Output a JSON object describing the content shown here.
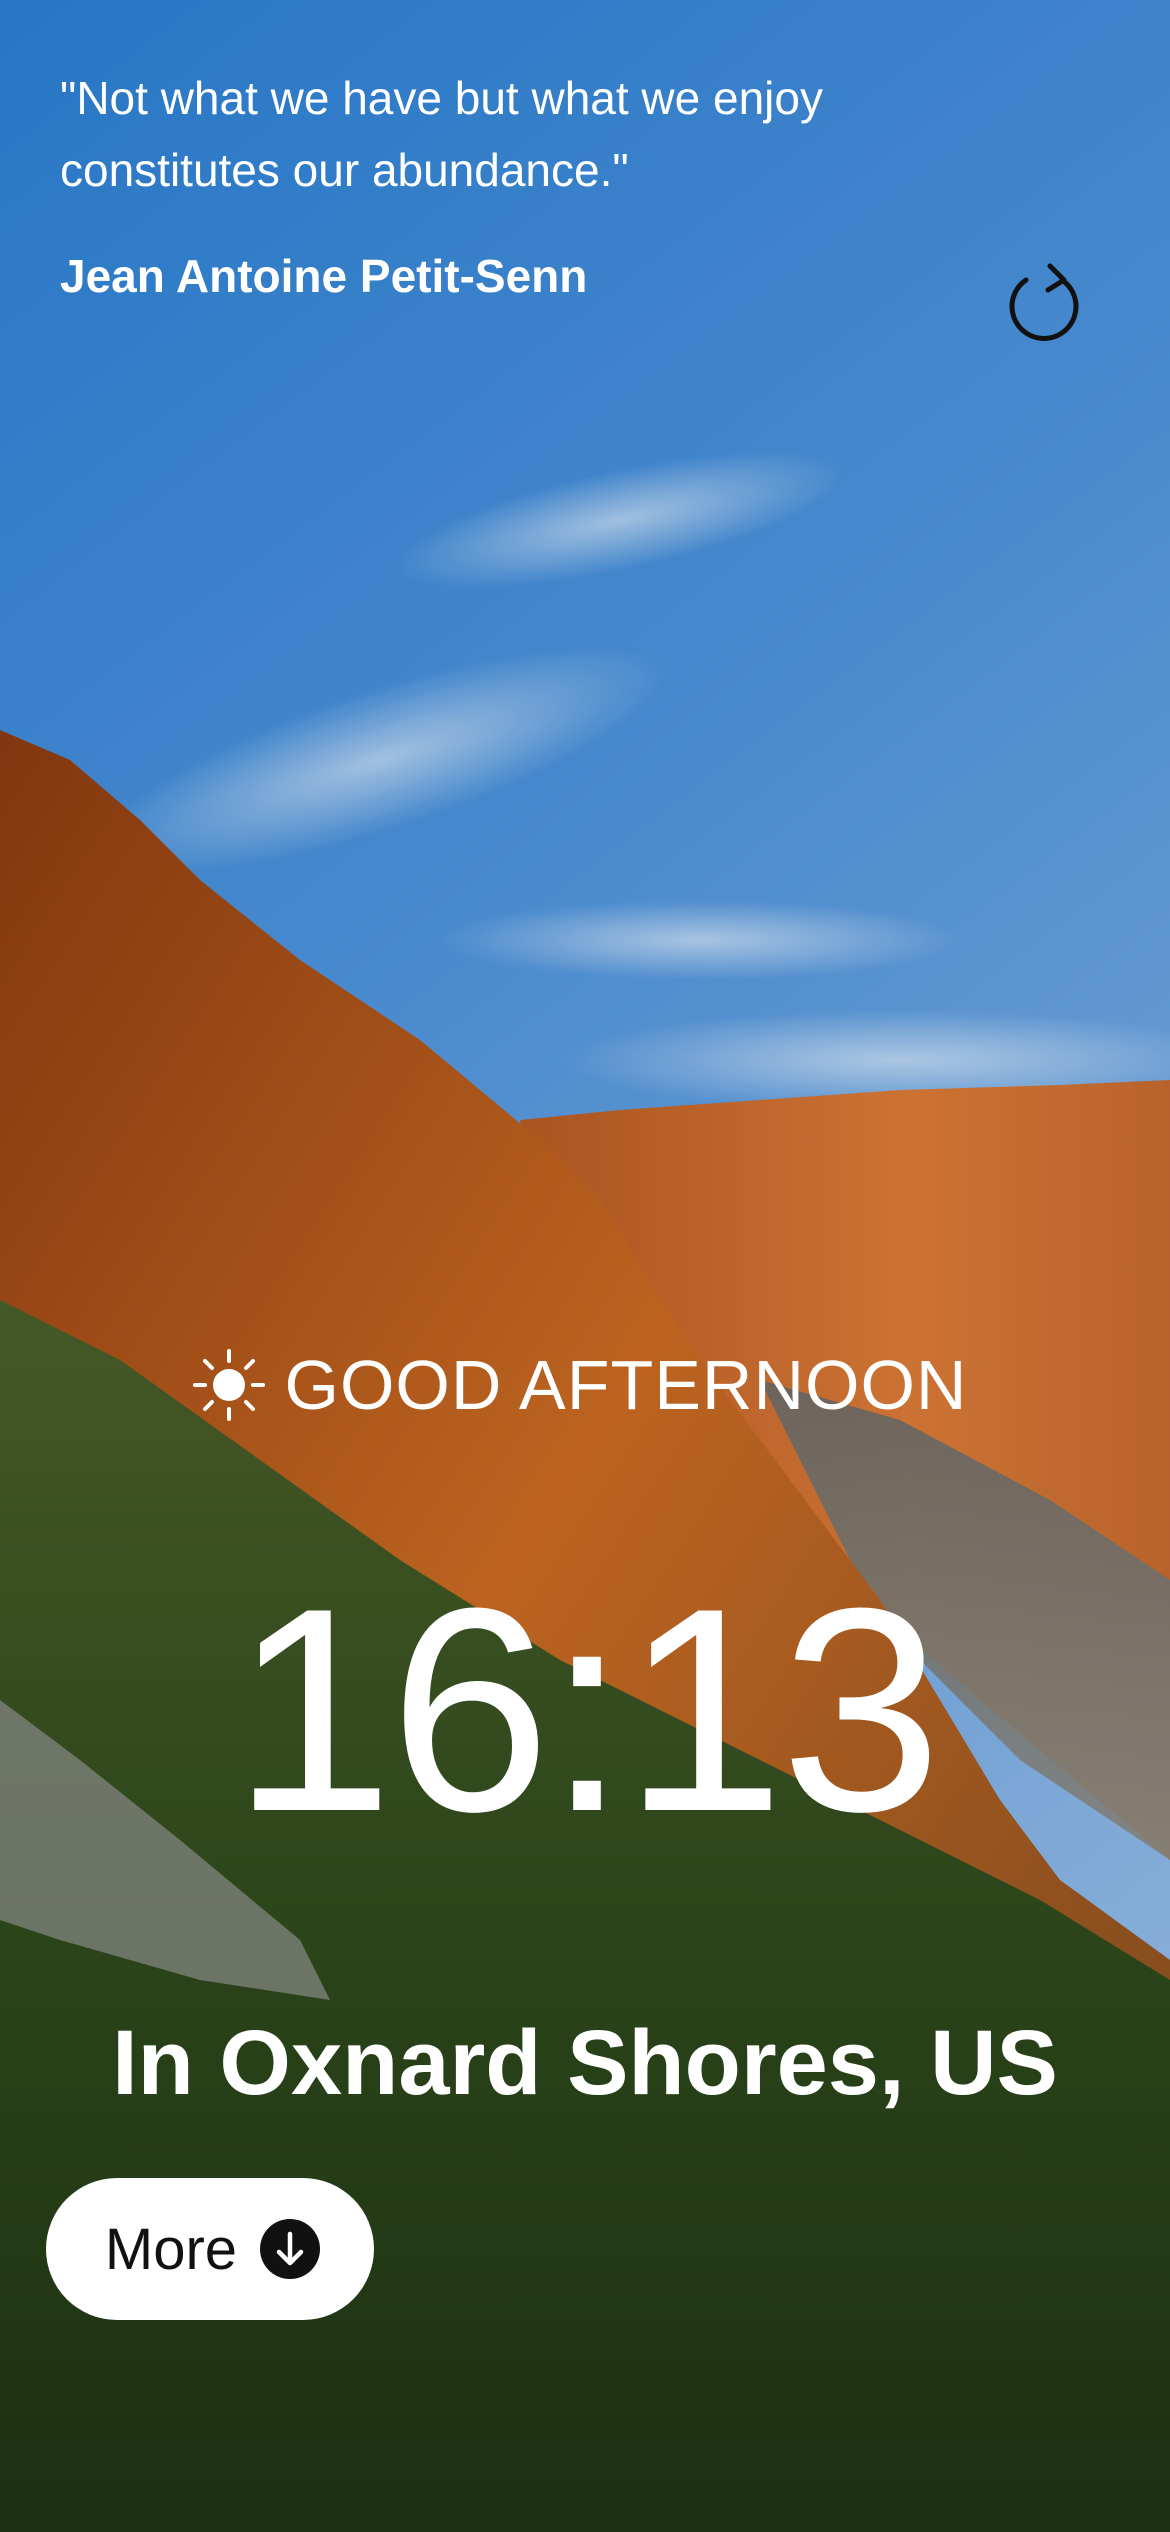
{
  "quote": {
    "text": "\"Not what we have but what we enjoy constitutes our abundance.\"",
    "author": "Jean Antoine Petit-Senn"
  },
  "greeting": {
    "icon": "sun-icon",
    "text": "GOOD AFTERNOON"
  },
  "clock": {
    "time": "16:13"
  },
  "location": {
    "text": "In Oxnard Shores, US"
  },
  "more_button": {
    "label": "More",
    "icon": "arrow-down-circle-icon"
  },
  "refresh_button": {
    "icon": "refresh-icon"
  },
  "colors": {
    "text": "#ffffff",
    "button_bg": "#ffffff",
    "button_text": "#111111",
    "sky_top": "#2f7ed0",
    "cliff": "#c8641e",
    "forest": "#2e4a1e"
  }
}
